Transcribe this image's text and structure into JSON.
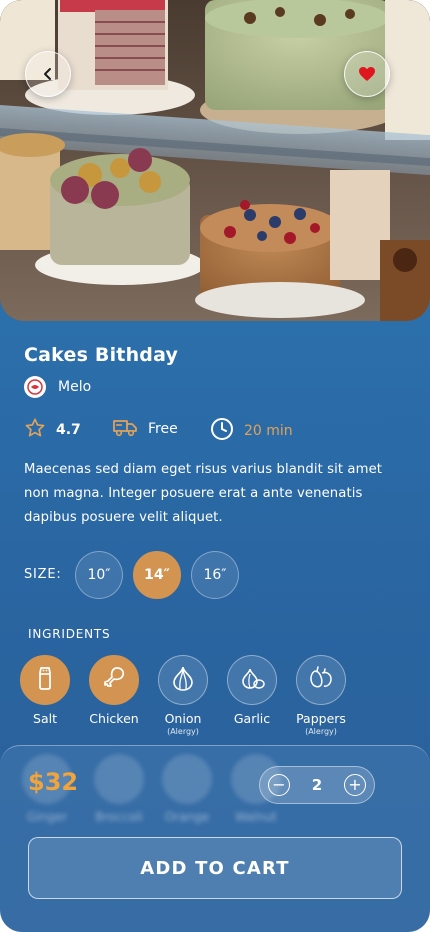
{
  "product": {
    "title": "Cakes Bithday",
    "shop_name": "Melo",
    "rating": "4.7",
    "delivery": "Free",
    "time": "20 min",
    "description": "Maecenas sed diam eget risus varius blandit sit amet non magna. Integer posuere erat a ante venenatis dapibus posuere velit aliquet."
  },
  "size": {
    "label": "SIZE:",
    "options": [
      "10″",
      "14″",
      "16″"
    ],
    "selected": "14″"
  },
  "ingredients": {
    "label": "INGRIDENTS",
    "items": [
      {
        "name": "Salt",
        "note": "",
        "icon": "salt-shaker-icon",
        "selected": true
      },
      {
        "name": "Chicken",
        "note": "",
        "icon": "chicken-leg-icon",
        "selected": true
      },
      {
        "name": "Onion",
        "note": "(Alergy)",
        "icon": "onion-icon",
        "selected": false
      },
      {
        "name": "Garlic",
        "note": "",
        "icon": "garlic-icon",
        "selected": false
      },
      {
        "name": "Pappers",
        "note": "(Alergy)",
        "icon": "peppers-icon",
        "selected": false
      }
    ],
    "more_items": [
      "Ginger",
      "Broccoli",
      "Orange",
      "Walnut"
    ]
  },
  "cart": {
    "price": "$32",
    "quantity": "2",
    "minus": "−",
    "plus": "+",
    "button_label": "ADD TO CART"
  },
  "icons": {
    "back": "chevron-left-icon",
    "favorite": "heart-icon",
    "rating": "star-icon",
    "delivery": "truck-icon",
    "time": "clock-icon",
    "shop_logo": "shop-logo-icon"
  },
  "colors": {
    "background": "#2b6fab",
    "accent": "#d39451",
    "price": "#f0a43c",
    "heart": "#e0161f"
  }
}
